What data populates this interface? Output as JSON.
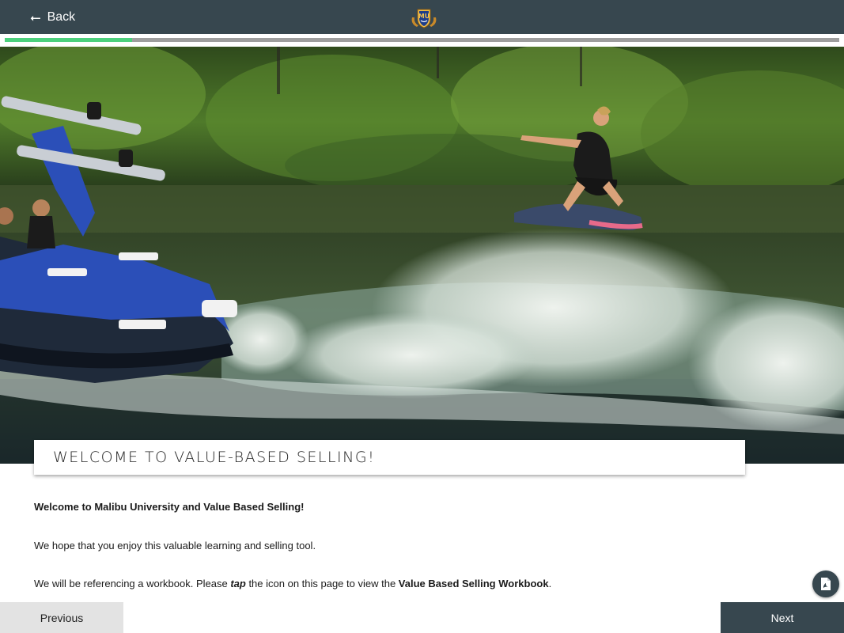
{
  "header": {
    "back_label": "Back",
    "back_icon": "arrow-left-icon",
    "logo_text": "MU"
  },
  "progress": {
    "value_fraction": 0.153
  },
  "hero_image": {
    "icon": "wakesurf-photo"
  },
  "page": {
    "title": "WELCOME TO VALUE-BASED SELLING!",
    "paragraph_1": "Welcome to Malibu University and Value Based Selling!",
    "paragraph_2": "We hope that you enjoy this valuable learning and selling tool.",
    "paragraph_3_before": "We will be referencing a workbook. Please ",
    "paragraph_3_tap": "tap",
    "paragraph_3_middle": " the icon on this page to view the ",
    "paragraph_3_workbook": "Value Based Selling Workbook",
    "paragraph_3_after": "."
  },
  "actions": {
    "pdf_icon": "pdf-document-icon",
    "previous_label": "Previous",
    "next_label": "Next"
  },
  "colors": {
    "header_bg": "#37474f",
    "progress_fill": "#4cd07d",
    "progress_track": "#9e9e9e",
    "prev_bg": "#e3e3e3",
    "next_bg": "#37474f"
  }
}
